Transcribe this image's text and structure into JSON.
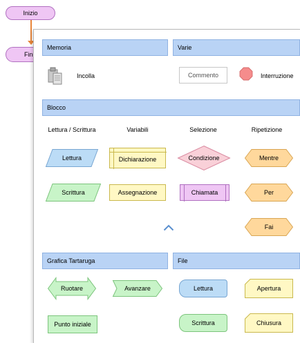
{
  "flowchart": {
    "start_label": "Inizio",
    "end_label": "Fine"
  },
  "palette": {
    "memory": {
      "title": "Memoria",
      "paste_label": "Incolla"
    },
    "misc": {
      "title": "Varie",
      "comment_label": "Commento",
      "stop_label": "Interruzione"
    },
    "block": {
      "title": "Blocco",
      "columns": [
        "Lettura / Scrittura",
        "Variabili",
        "Selezione",
        "Ripetizione"
      ],
      "read_label": "Lettura",
      "write_label": "Scrittura",
      "declare_label": "Dichiarazione",
      "assign_label": "Assegnazione",
      "condition_label": "Condizione",
      "call_label": "Chiamata",
      "while_label": "Mentre",
      "for_label": "Per",
      "do_label": "Fai"
    },
    "turtle": {
      "title": "Grafica Tartaruga",
      "rotate_label": "Ruotare",
      "forward_label": "Avanzare",
      "home_label": "Punto iniziale"
    },
    "file": {
      "title": "File",
      "read_label": "Lettura",
      "open_label": "Apertura",
      "write_label": "Scrittura",
      "close_label": "Chiusura"
    }
  },
  "colors": {
    "header": "#b9d3f5",
    "io": "#bcdcf6",
    "yellow": "#fff8c4",
    "pink": "#f9d0d8",
    "orange": "#ffd89c",
    "green": "#c8f4c8",
    "stop": "#f58c8c"
  },
  "icons": {
    "paste": "clipboard-paste-icon",
    "stop": "stop-octagon-icon",
    "collapse": "chevron-up-icon"
  }
}
